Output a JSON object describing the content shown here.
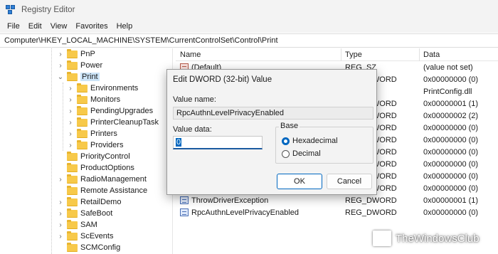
{
  "window": {
    "title": "Registry Editor"
  },
  "menu": [
    "File",
    "Edit",
    "View",
    "Favorites",
    "Help"
  ],
  "address": "Computer\\HKEY_LOCAL_MACHINE\\SYSTEM\\CurrentControlSet\\Control\\Print",
  "tree": {
    "parents": [
      {
        "label": "PnP"
      },
      {
        "label": "Power"
      },
      {
        "label": "Print",
        "expanded": true
      }
    ],
    "children": [
      "Environments",
      "Monitors",
      "PendingUpgrades",
      "PrinterCleanupTask",
      "Printers",
      "Providers"
    ],
    "siblings": [
      "PriorityControl",
      "ProductOptions",
      "RadioManagement",
      "Remote Assistance",
      "RetailDemo",
      "SafeBoot",
      "SAM",
      "ScEvents",
      "SCMConfig"
    ]
  },
  "list": {
    "columns": [
      "Name",
      "Type",
      "Data"
    ],
    "rows": [
      {
        "name": "(Default)",
        "type": "REG_SZ",
        "data": "(value not set)",
        "kind": "sz"
      },
      {
        "name": "",
        "type": "REG_DWORD",
        "data": "0x00000000 (0)",
        "kind": "dw"
      },
      {
        "name": "",
        "type": "",
        "data": "PrintConfig.dll",
        "kind": ""
      },
      {
        "name": "",
        "type": "REG_DWORD",
        "data": "0x00000001 (1)",
        "kind": "dw"
      },
      {
        "name": "",
        "type": "REG_DWORD",
        "data": "0x00000002 (2)",
        "kind": "dw"
      },
      {
        "name": "",
        "type": "REG_DWORD",
        "data": "0x00000000 (0)",
        "kind": "dw"
      },
      {
        "name": "",
        "type": "REG_DWORD",
        "data": "0x00000000 (0)",
        "kind": "dw"
      },
      {
        "name": "",
        "type": "REG_DWORD",
        "data": "0x00000000 (0)",
        "kind": "dw"
      },
      {
        "name": "",
        "type": "REG_DWORD",
        "data": "0x00000000 (0)",
        "kind": "dw"
      },
      {
        "name": "",
        "type": "REG_DWORD",
        "data": "0x00000000 (0)",
        "kind": "dw"
      },
      {
        "name": "",
        "type": "REG_DWORD",
        "data": "0x00000000 (0)",
        "kind": "dw"
      },
      {
        "name": "ThrowDriverException",
        "type": "REG_DWORD",
        "data": "0x00000001 (1)",
        "kind": "dw"
      },
      {
        "name": "RpcAuthnLevelPrivacyEnabled",
        "type": "REG_DWORD",
        "data": "0x00000000 (0)",
        "kind": "dw"
      }
    ]
  },
  "dialog": {
    "title": "Edit DWORD (32-bit) Value",
    "value_name_label": "Value name:",
    "value_name": "RpcAuthnLevelPrivacyEnabled",
    "value_data_label": "Value data:",
    "value_data": "0",
    "base_label": "Base",
    "hex_label": "Hexadecimal",
    "dec_label": "Decimal",
    "selected_base": "Hexadecimal",
    "ok_label": "OK",
    "cancel_label": "Cancel"
  },
  "watermark": "TheWindowsClub"
}
